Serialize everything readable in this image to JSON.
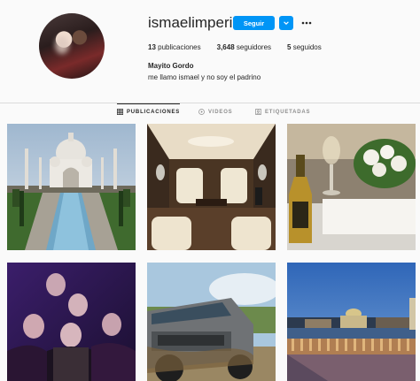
{
  "profile": {
    "username": "ismaelimperial",
    "follow_label": "Seguir",
    "stats": {
      "posts_count": "13",
      "posts_label": "publicaciones",
      "followers_count": "3,648",
      "followers_label": "seguidores",
      "following_count": "5",
      "following_label": "seguidos"
    },
    "full_name": "Mayito Gordo",
    "bio": "me llamo ismael y no soy el padrino"
  },
  "tabs": [
    {
      "label": "PUBLICACIONES",
      "icon": "grid-icon",
      "active": true
    },
    {
      "label": "VIDEOS",
      "icon": "video-icon",
      "active": false
    },
    {
      "label": "ETIQUETADAS",
      "icon": "tag-icon",
      "active": false
    }
  ],
  "colors": {
    "accent": "#0095f6",
    "text": "#262626",
    "muted": "#8e8e8e",
    "background": "#fafafa"
  }
}
